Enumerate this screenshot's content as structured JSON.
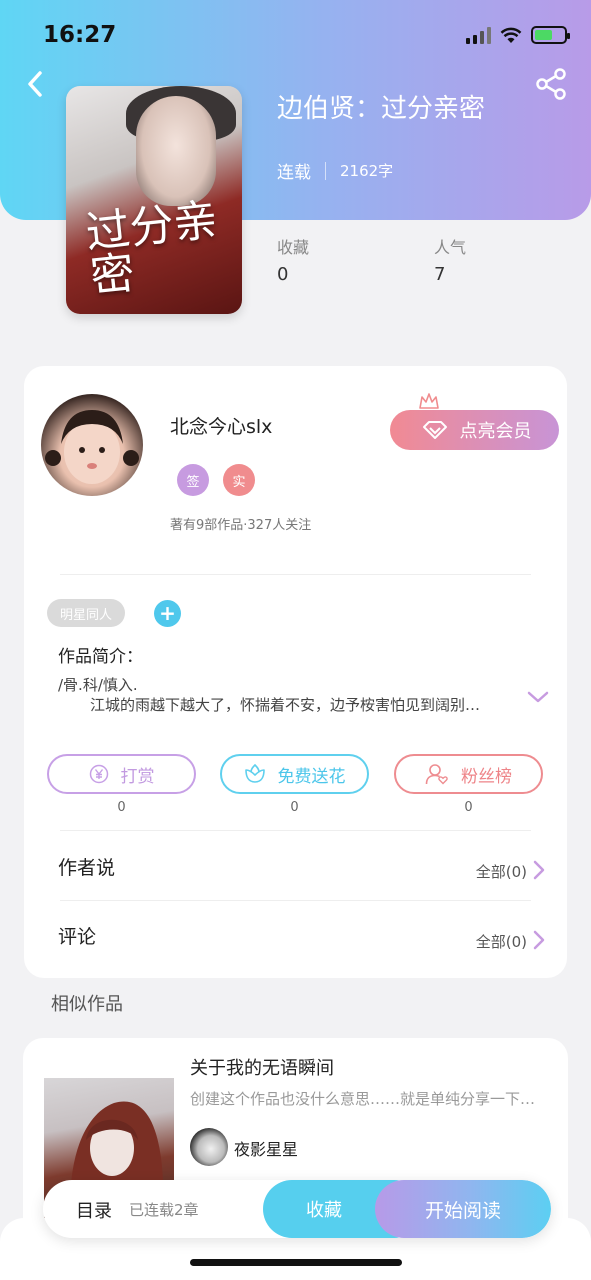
{
  "status_bar": {
    "time": "16:27"
  },
  "book": {
    "title": "边伯贤：过分亲密",
    "status": "连载",
    "word_count": "2162字",
    "cover_title": "过分亲密",
    "favorites_label": "收藏",
    "favorites_value": "0",
    "popularity_label": "人气",
    "popularity_value": "7"
  },
  "author": {
    "name": "北念今心slx",
    "badge_signed": "签",
    "badge_verified": "实",
    "stats": "著有9部作品·327人关注",
    "vip_label": "点亮会员"
  },
  "tags": {
    "items": [
      "明星同人"
    ],
    "add_symbol": "+"
  },
  "intro": {
    "heading": "作品简介：",
    "line1": "/骨.科/慎入.",
    "line2": "江城的雨越下越大了，怀揣着不安，边予桉害怕见到阔别…"
  },
  "actions": [
    {
      "label": "打赏",
      "count": "0",
      "color": "#c7a0e6"
    },
    {
      "label": "免费送花",
      "count": "0",
      "color": "#5fd0ee"
    },
    {
      "label": "粉丝榜",
      "count": "0",
      "color": "#ee8c90"
    }
  ],
  "author_says": {
    "title": "作者说",
    "link": "全部(0)"
  },
  "comments": {
    "title": "评论",
    "link": "全部(0)"
  },
  "similar": {
    "heading": "相似作品",
    "items": [
      {
        "title": "关于我的无语瞬间",
        "desc": "创建这个作品也没什么意思……就是单纯分享一下…",
        "author": "夜影星星"
      }
    ]
  },
  "dock": {
    "toc_label": "目录",
    "chapters": "已连载2章",
    "favorite_label": "收藏",
    "read_label": "开始阅读"
  },
  "colors": {
    "accent_blue": "#56cfee",
    "accent_purple": "#b79ae8",
    "accent_pink": "#f18a93"
  }
}
